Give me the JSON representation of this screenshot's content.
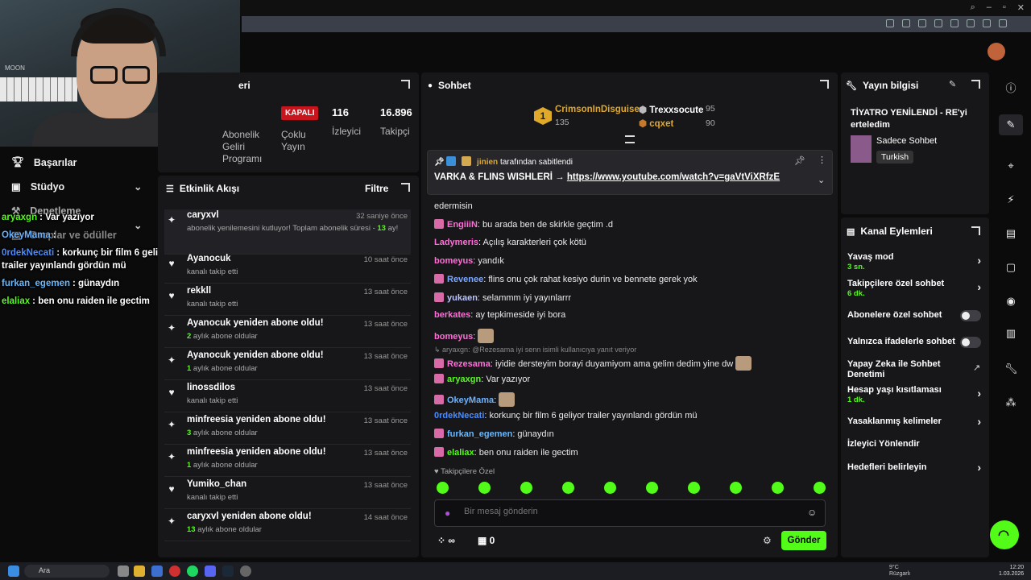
{
  "stats": {
    "partial_label": "eri",
    "offline_badge": "KAPALI",
    "viewers_value": "116",
    "viewers_label": "İzleyici",
    "followers_value": "16.896",
    "followers_label": "Takipçi",
    "multistream_label": "Çoklu Yayın",
    "partner_label_1": "Abonelik",
    "partner_label_2": "Geliri",
    "partner_label_3": "Programı"
  },
  "leftnav": {
    "achievements": "Başarılar",
    "studio": "Stüdyo",
    "moderation": "Denetleme",
    "drops": "Droplar ve ödüller"
  },
  "overlay_chat": [
    {
      "user": "aryaxgn",
      "text": ": Var yazıyor",
      "color": "#53fc18"
    },
    {
      "user": "OkeyMama",
      "text": ":",
      "color": "#6cb2ff"
    },
    {
      "user": "0rdekNecati",
      "text": ": korkunç bir film 6 geliyor trailer yayınlandı gördün mü",
      "color": "#4a8cff"
    },
    {
      "user": "furkan_egemen",
      "text": ": günaydın",
      "color": "#66b8ff"
    },
    {
      "user": "elaliax",
      "text": ": ben onu raiden ile gectim",
      "color": "#53fc18"
    }
  ],
  "activity": {
    "title": "Etkinlik Akışı",
    "filter": "Filtre",
    "items": [
      {
        "title": "caryxvl",
        "sub": "abonelik yenilemesini kutluyor! Toplam abonelik süresi - ",
        "highlight": "13",
        "sub_tail": " ay!",
        "time": "32 saniye önce",
        "icon": "sparkle-icon"
      },
      {
        "title": "Ayanocuk",
        "sub": "kanalı takip etti",
        "highlight": "",
        "sub_tail": "",
        "time": "10 saat önce",
        "icon": "heart-icon"
      },
      {
        "title": "rekkll",
        "sub": "kanalı takip etti",
        "highlight": "",
        "sub_tail": "",
        "time": "13 saat önce",
        "icon": "heart-icon"
      },
      {
        "title": "Ayanocuk yeniden abone oldu!",
        "sub": "",
        "highlight": "2",
        "sub_tail": " aylık abone oldular",
        "time": "13 saat önce",
        "icon": "sparkle-icon"
      },
      {
        "title": "Ayanocuk yeniden abone oldu!",
        "sub": "",
        "highlight": "1",
        "sub_tail": " aylık abone oldular",
        "time": "13 saat önce",
        "icon": "sparkle-icon"
      },
      {
        "title": "linossdilos",
        "sub": "kanalı takip etti",
        "highlight": "",
        "sub_tail": "",
        "time": "13 saat önce",
        "icon": "heart-icon"
      },
      {
        "title": "minfreesia yeniden abone oldu!",
        "sub": "",
        "highlight": "3",
        "sub_tail": " aylık abone oldular",
        "time": "13 saat önce",
        "icon": "sparkle-icon"
      },
      {
        "title": "minfreesia yeniden abone oldu!",
        "sub": "",
        "highlight": "1",
        "sub_tail": " aylık abone oldular",
        "time": "13 saat önce",
        "icon": "sparkle-icon"
      },
      {
        "title": "Yumiko_chan",
        "sub": "kanalı takip etti",
        "highlight": "",
        "sub_tail": "",
        "time": "13 saat önce",
        "icon": "heart-icon"
      },
      {
        "title": "caryxvl yeniden abone oldu!",
        "sub": "",
        "highlight": "13",
        "sub_tail": " aylık abone oldular",
        "time": "14 saat önce",
        "icon": "sparkle-icon"
      }
    ]
  },
  "chat": {
    "title": "Sohbet",
    "leaders": [
      {
        "rank": "1",
        "name": "CrimsonInDisguise",
        "count": "135"
      },
      {
        "name": "Trexxsocute",
        "count": "95"
      },
      {
        "name": "cqxet",
        "count": "90"
      }
    ],
    "pinned": {
      "by_user": "jinien",
      "by_text": "tarafından sabitlendi",
      "text": "VARKA & FLINS WISHLERİ →",
      "link": "https://www.youtube.com/watch?v=gaVtViXRfzE"
    },
    "partial_line": "edermisin",
    "messages": [
      {
        "user": "EngiiiN",
        "text": ": bu arada ben de skirkle geçtim .d",
        "color": "#ff6fd8"
      },
      {
        "user": "Ladymeris",
        "text": ": Açılış karakterleri çok kötü",
        "color": "#ff6fd8"
      },
      {
        "user": "bomeyus",
        "text": ": yandık",
        "color": "#ff6fd8"
      },
      {
        "user": "Revenee",
        "text": ": flins onu çok rahat kesiyo durin ve bennete gerek yok",
        "color": "#7aa7ff"
      },
      {
        "user": "yukaen",
        "text": ": selammm iyi yayınlarrr",
        "color": "#b9c4ff"
      },
      {
        "user": "berkates",
        "text": ": ay tepkimeside iyi bora",
        "color": "#ff6fd8"
      },
      {
        "user": "bomeyus",
        "text": ":",
        "color": "#ff6fd8"
      },
      {
        "user": "Rezesama",
        "text": ": iyidie dersteyim borayi duyamiyom ama gelim dedim yine dw",
        "color": "#ff6fd8"
      },
      {
        "user": "aryaxgn",
        "text": ": Var yazıyor",
        "color": "#53fc18"
      },
      {
        "user": "OkeyMama",
        "text": ":",
        "color": "#6cb2ff"
      },
      {
        "user": "0rdekNecati",
        "text": ": korkunç bir film 6 geliyor trailer yayınlandı gördün mü",
        "color": "#4a8cff"
      },
      {
        "user": "furkan_egemen",
        "text": ": günaydın",
        "color": "#66b8ff"
      },
      {
        "user": "elaliax",
        "text": ": ben onu raiden ile gectim",
        "color": "#53fc18"
      }
    ],
    "reply_hint": "aryaxgn: @Rezesama iyi senn isimli kullanıcıya yanıt veriyor",
    "followers_only": "Takipçilere Özel",
    "input_placeholder": "Bir mesaj gönderin",
    "points_value": "0",
    "send": "Gönder"
  },
  "info": {
    "title": "Yayın bilgisi",
    "stream_title": "TİYATRO YENİLENDİ - RE'yi erteledim",
    "category": "Sadece Sohbet",
    "language": "Turkish"
  },
  "actions": {
    "title": "Kanal Eylemleri",
    "slow_mode": "Yavaş mod",
    "slow_mode_val": "3 sn.",
    "follower_chat": "Takipçilere özel sohbet",
    "follower_chat_val": "6 dk.",
    "sub_chat": "Abonelere özel sohbet",
    "emote_chat": "Yalnızca ifadelerle sohbet",
    "ai_mod": "Yapay Zeka ile Sohbet Denetimi",
    "account_age": "Hesap yaşı kısıtlaması",
    "account_age_val": "1 dk.",
    "banned_words": "Yasaklanmış kelimeler",
    "redirect": "İzleyici Yönlendir",
    "goals": "Hedefleri belirleyin"
  },
  "taskbar": {
    "search": "Ara",
    "weather_temp": "9°C",
    "weather_text": "Rüzgarlı",
    "time": "12:20",
    "date": "1.03.2026"
  },
  "colors": {
    "accent": "#53fc18",
    "offline": "#c8141c"
  }
}
